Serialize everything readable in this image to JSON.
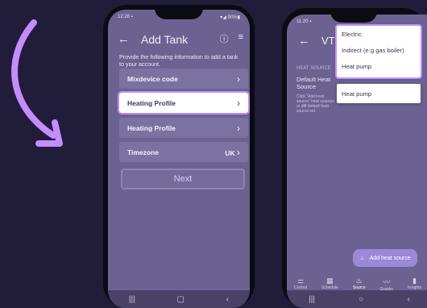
{
  "colors": {
    "background": "#211c3a",
    "highlight": "#c48cff",
    "screen": "#6b6291"
  },
  "left_phone": {
    "status_time": "12:28 ▪",
    "status_right": "▾◢ 90%▮",
    "header_title": "Add Tank",
    "back_icon": "←",
    "info_icon": "ⓘ",
    "menu_icon": "≡",
    "description": "Provide the following information to add a tank to your account.",
    "rows": [
      {
        "label": "Mixdevice code",
        "value": ""
      },
      {
        "label": "Heating Profile",
        "value": ""
      },
      {
        "label": "Heating Profile",
        "value": ""
      },
      {
        "label": "Timezone",
        "value": "UK"
      }
    ],
    "chevron": "›",
    "next_label": "Next",
    "nav": [
      "|||",
      "▢",
      "‹"
    ]
  },
  "right_phone": {
    "status_time": "11:20 ▪",
    "header_title": "VT00",
    "back_icon": "←",
    "section_label": "HEAT SOURCE",
    "default_label_1": "Default Heat",
    "default_label_2": "Source",
    "help_text": "Click \"Add heat source\" heat sources or diff default heat source set.",
    "dropdown_options": [
      "Electric",
      "Indirect (e.g gas boiler)",
      "Heat pump"
    ],
    "selected_value": "Heat pump",
    "fab_label": "Add heat source",
    "fab_icon": "♨",
    "tabs": [
      {
        "icon": "⚌",
        "label": "Control"
      },
      {
        "icon": "▦",
        "label": "Schedule"
      },
      {
        "icon": "♨",
        "label": "Source"
      },
      {
        "icon": "〰",
        "label": "Graphs"
      },
      {
        "icon": "▮",
        "label": "Insights"
      }
    ],
    "nav": [
      "|||",
      "○",
      "‹"
    ]
  }
}
